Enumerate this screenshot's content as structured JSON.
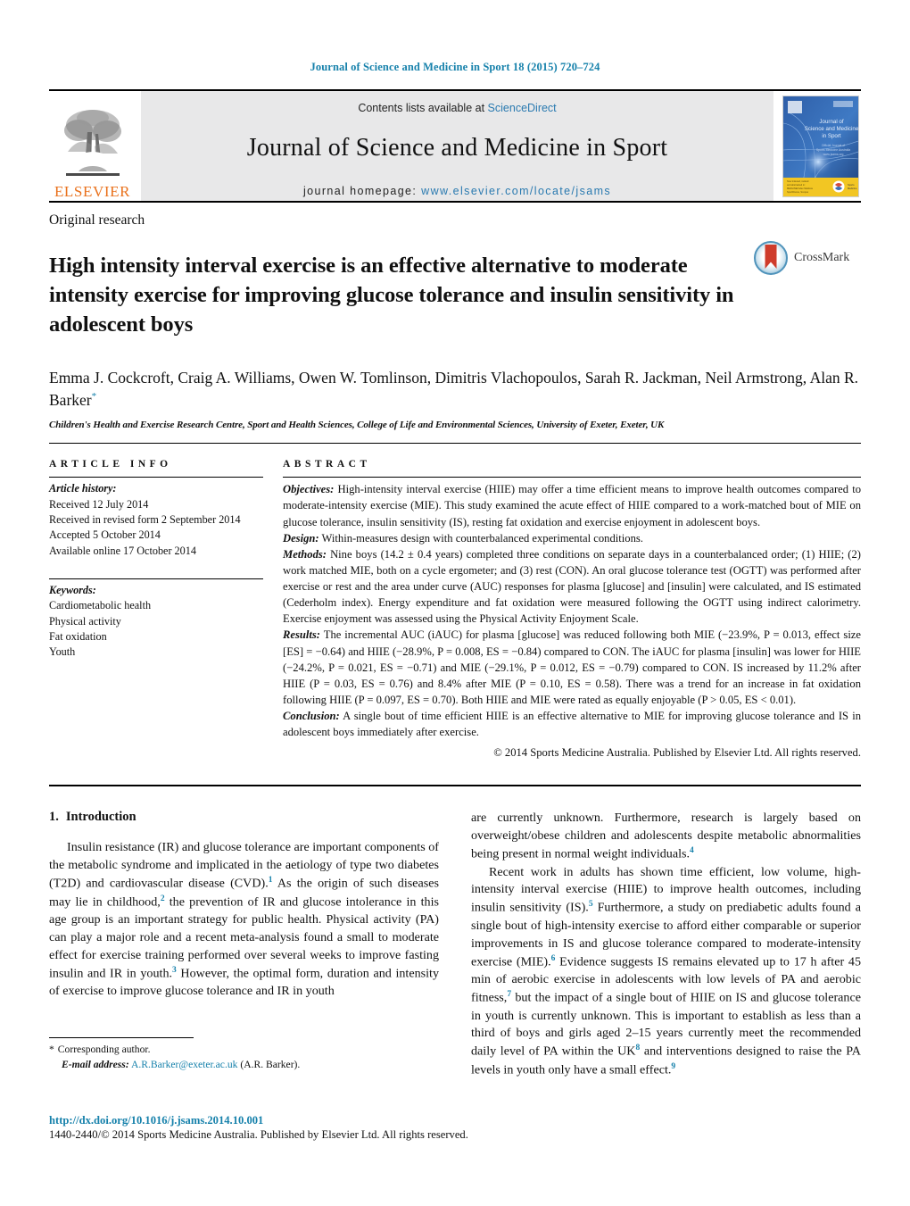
{
  "running_head": "Journal of Science and Medicine in Sport 18 (2015) 720–724",
  "masthead": {
    "publisher_logo_label": "ELSEVIER",
    "contents_prefix": "Contents lists available at",
    "contents_link": "ScienceDirect",
    "journal_name": "Journal of Science and Medicine in Sport",
    "homepage_prefix": "journal homepage:",
    "homepage_url": "www.elsevier.com/locate/jsams",
    "cover_title": "Journal of Science and Medicine in Sport"
  },
  "article": {
    "type": "Original research",
    "title": "High intensity interval exercise is an effective alternative to moderate intensity exercise for improving glucose tolerance and insulin sensitivity in adolescent boys",
    "crossmark_label": "CrossMark",
    "authors": "Emma J. Cockcroft, Craig A. Williams, Owen W. Tomlinson, Dimitris Vlachopoulos, Sarah R. Jackman, Neil Armstrong, Alan R. Barker",
    "corresponding_marker": "*",
    "affiliation": "Children's Health and Exercise Research Centre, Sport and Health Sciences, College of Life and Environmental Sciences, University of Exeter, Exeter, UK"
  },
  "article_info": {
    "heading": "ARTICLE INFO",
    "history_label": "Article history:",
    "history": [
      "Received 12 July 2014",
      "Received in revised form 2 September 2014",
      "Accepted 5 October 2014",
      "Available online 17 October 2014"
    ],
    "keywords_label": "Keywords:",
    "keywords": [
      "Cardiometabolic health",
      "Physical activity",
      "Fat oxidation",
      "Youth"
    ]
  },
  "abstract": {
    "heading": "ABSTRACT",
    "objectives_label": "Objectives:",
    "objectives_text": " High-intensity interval exercise (HIIE) may offer a time efficient means to improve health outcomes compared to moderate-intensity exercise (MIE). This study examined the acute effect of HIIE compared to a work-matched bout of MIE on glucose tolerance, insulin sensitivity (IS), resting fat oxidation and exercise enjoyment in adolescent boys.",
    "design_label": "Design:",
    "design_text": " Within-measures design with counterbalanced experimental conditions.",
    "methods_label": "Methods:",
    "methods_text": " Nine boys (14.2 ± 0.4 years) completed three conditions on separate days in a counterbalanced order; (1) HIIE; (2) work matched MIE, both on a cycle ergometer; and (3) rest (CON). An oral glucose tolerance test (OGTT) was performed after exercise or rest and the area under curve (AUC) responses for plasma [glucose] and [insulin] were calculated, and IS estimated (Cederholm index). Energy expenditure and fat oxidation were measured following the OGTT using indirect calorimetry. Exercise enjoyment was assessed using the Physical Activity Enjoyment Scale.",
    "results_label": "Results:",
    "results_text": " The incremental AUC (iAUC) for plasma [glucose] was reduced following both MIE (−23.9%, P = 0.013, effect size [ES] = −0.64) and HIIE (−28.9%, P = 0.008, ES = −0.84) compared to CON. The iAUC for plasma [insulin] was lower for HIIE (−24.2%, P = 0.021, ES = −0.71) and MIE (−29.1%, P = 0.012, ES = −0.79) compared to CON. IS increased by 11.2% after HIIE (P = 0.03, ES = 0.76) and 8.4% after MIE (P = 0.10, ES = 0.58). There was a trend for an increase in fat oxidation following HIIE (P = 0.097, ES = 0.70). Both HIIE and MIE were rated as equally enjoyable (P > 0.05, ES < 0.01).",
    "conclusion_label": "Conclusion:",
    "conclusion_text": " A single bout of time efficient HIIE is an effective alternative to MIE for improving glucose tolerance and IS in adolescent boys immediately after exercise.",
    "copyright": "© 2014 Sports Medicine Australia. Published by Elsevier Ltd. All rights reserved."
  },
  "body": {
    "section_number": "1.",
    "section_title": "Introduction",
    "left_paragraph_1_a": "Insulin resistance (IR) and glucose tolerance are important components of the metabolic syndrome and implicated in the aetiology of type two diabetes (T2D) and cardiovascular disease (CVD).",
    "left_ref_1": "1",
    "left_paragraph_1_b": " As the origin of such diseases may lie in childhood,",
    "left_ref_2": "2",
    "left_paragraph_1_c": " the prevention of IR and glucose intolerance in this age group is an important strategy for public health. Physical activity (PA) can play a major role and a recent meta-analysis found a small to moderate effect for exercise training performed over several weeks to improve fasting insulin and IR in youth.",
    "left_ref_3": "3",
    "left_paragraph_1_d": " However, the optimal form, duration and intensity of exercise to improve glucose tolerance and IR in youth",
    "right_paragraph_1_a": "are currently unknown. Furthermore, research is largely based on overweight/obese children and adolescents despite metabolic abnormalities being present in normal weight individuals.",
    "right_ref_4": "4",
    "right_paragraph_2_a": "Recent work in adults has shown time efficient, low volume, high-intensity interval exercise (HIIE) to improve health outcomes, including insulin sensitivity (IS).",
    "right_ref_5": "5",
    "right_paragraph_2_b": " Furthermore, a study on prediabetic adults found a single bout of high-intensity exercise to afford either comparable or superior improvements in IS and glucose tolerance compared to moderate-intensity exercise (MIE).",
    "right_ref_6": "6",
    "right_paragraph_2_c": " Evidence suggests IS remains elevated up to 17 h after 45 min of aerobic exercise in adolescents with low levels of PA and aerobic fitness,",
    "right_ref_7": "7",
    "right_paragraph_2_d": " but the impact of a single bout of HIIE on IS and glucose tolerance in youth is currently unknown. This is important to establish as less than a third of boys and girls aged 2–15 years currently meet the recommended daily level of PA within the UK",
    "right_ref_8": "8",
    "right_paragraph_2_e": " and interventions designed to raise the PA levels in youth only have a small effect.",
    "right_ref_9": "9"
  },
  "footnotes": {
    "corresponding_star": "*",
    "corresponding_text": "Corresponding author.",
    "email_label": "E-mail address:",
    "email_address": "A.R.Barker@exeter.ac.uk",
    "email_owner": "(A.R. Barker)."
  },
  "page_footer": {
    "doi": "http://dx.doi.org/10.1016/j.jsams.2014.10.001",
    "issn_line": "1440-2440/© 2014 Sports Medicine Australia. Published by Elsevier Ltd. All rights reserved."
  },
  "colors": {
    "link": "#1681ab",
    "sciencedirect": "#2a7ab0",
    "elsevier_orange": "#e9711c",
    "banner_bg": "#e8e8e9",
    "crossmark_red": "#cf3c2c"
  }
}
